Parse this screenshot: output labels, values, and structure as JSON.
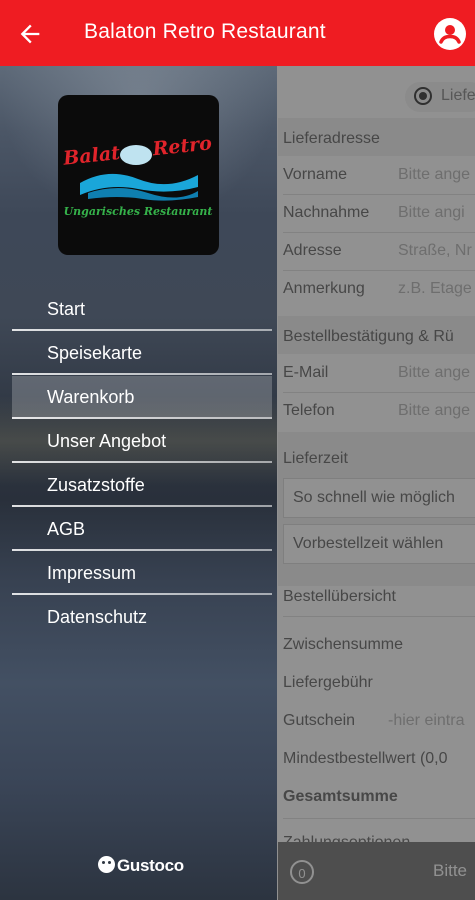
{
  "appbar": {
    "title": "Balaton Retro Restaurant",
    "back_icon": "arrow-left-icon",
    "account_icon": "account-circle-icon",
    "color": "#ef1c22"
  },
  "logo": {
    "line1": "Balaton Retro",
    "line2": "Ungarisches Restaurant"
  },
  "menu": [
    {
      "label": "Start",
      "active": false
    },
    {
      "label": "Speisekarte",
      "active": false
    },
    {
      "label": "Warenkorb",
      "active": true
    },
    {
      "label": "Unser Angebot",
      "active": false
    },
    {
      "label": "Zusatzstoffe",
      "active": false
    },
    {
      "label": "AGB",
      "active": false
    },
    {
      "label": "Impressum",
      "active": false
    },
    {
      "label": "Datenschutz",
      "active": false
    }
  ],
  "footer_brand": "Gustoco",
  "order": {
    "radio_label": "Liefe",
    "address_header": "Lieferadresse",
    "fields": [
      {
        "label": "Vorname",
        "placeholder": "Bitte ange"
      },
      {
        "label": "Nachnahme",
        "placeholder": "Bitte angi"
      },
      {
        "label": "Adresse",
        "placeholder": "Straße, Nr"
      },
      {
        "label": "Anmerkung",
        "placeholder": "z.B. Etage"
      }
    ],
    "confirm_header": "Bestellbestätigung & Rü",
    "contact_fields": [
      {
        "label": "E-Mail",
        "placeholder": "Bitte ange"
      },
      {
        "label": "Telefon",
        "placeholder": "Bitte ange"
      }
    ],
    "delivery_header": "Lieferzeit",
    "delivery_options": [
      "So schnell wie möglich",
      "Vorbestellzeit wählen"
    ],
    "summary_header": "Bestellübersicht",
    "subtotal_label": "Zwischensumme",
    "fee_label": "Liefergebühr",
    "voucher_label": "Gutschein",
    "voucher_placeholder": "-hier eintra",
    "minimum_label": "Mindestbestellwert (0,0",
    "total_label": "Gesamtsumme",
    "payment_label": "Zahlungsoptionen",
    "cart_count": "0",
    "submit_label": "Bitte"
  }
}
